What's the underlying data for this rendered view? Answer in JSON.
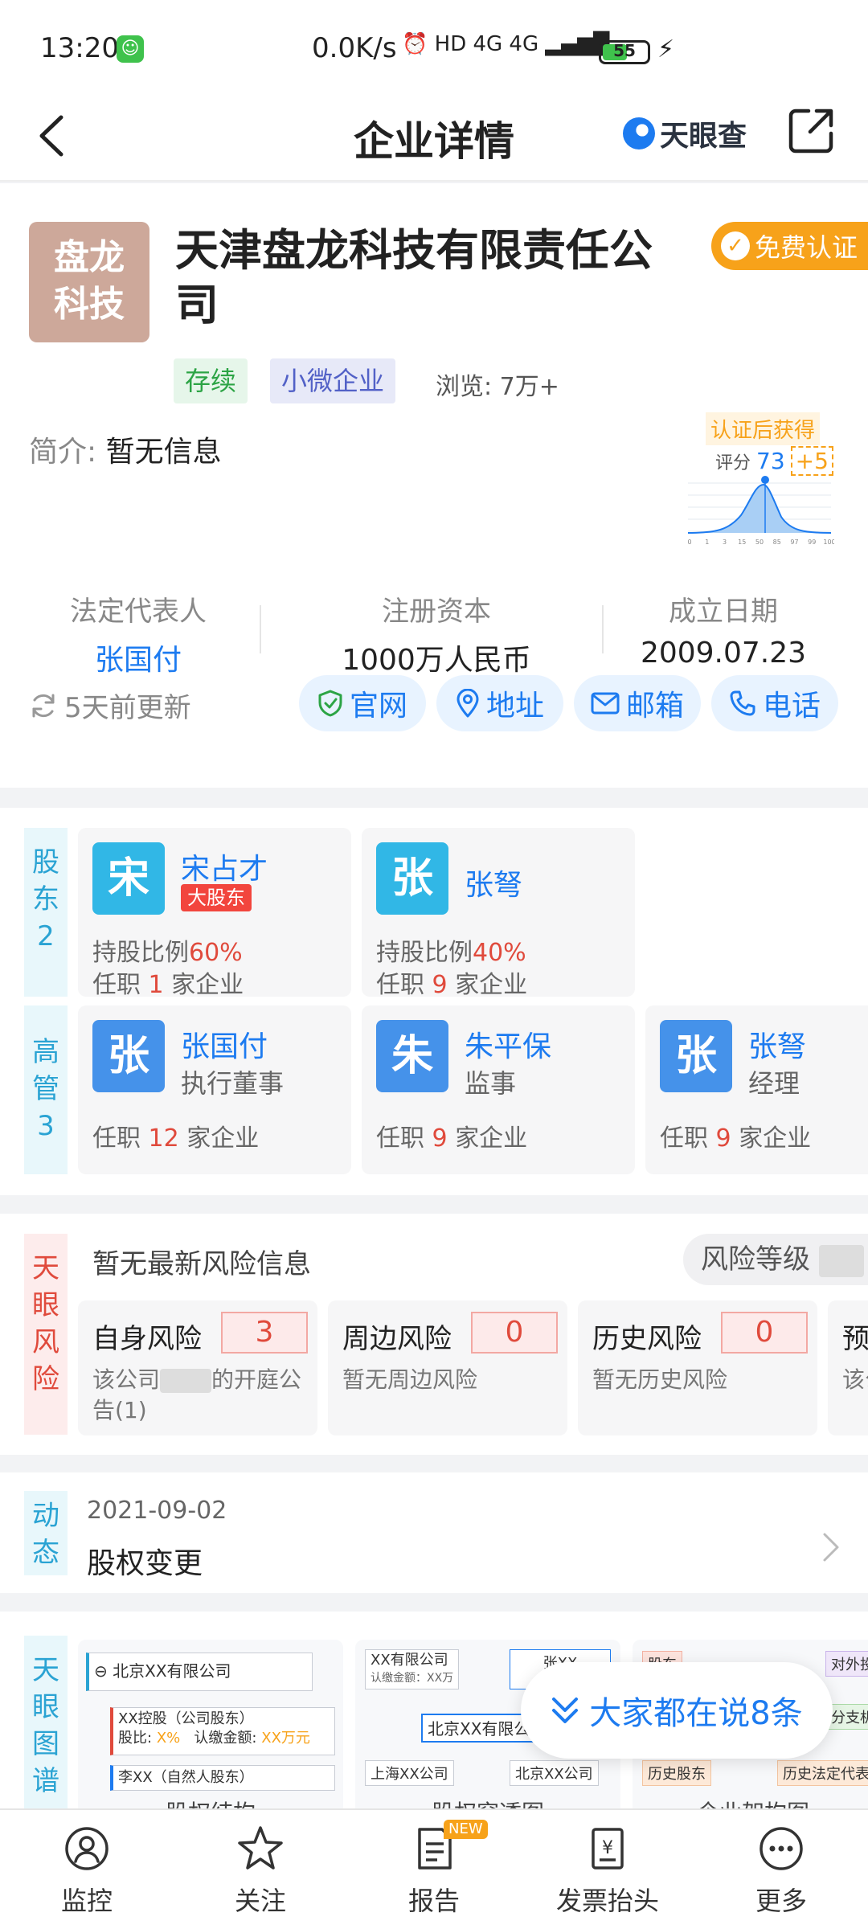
{
  "status": {
    "time": "13:20",
    "speed": "0.0K/s",
    "net": "HD 4G 4G",
    "battery": "55",
    "battery_level": 0.55
  },
  "nav": {
    "title": "企业详情",
    "logo_text": "天眼查"
  },
  "company": {
    "logo_line1": "盘龙",
    "logo_line2": "科技",
    "name": "天津盘龙科技有限责任公司",
    "cert_label": "免费认证",
    "tags": [
      "存续",
      "小微企业"
    ],
    "views_label": "浏览:",
    "views": "7万+",
    "intro_label": "简介:",
    "intro": "暂无信息",
    "score_header": "认证后获得",
    "score_label": "评分",
    "score": "73",
    "score_plus": "+5",
    "score_axis": [
      "0",
      "1",
      "3",
      "15",
      "50",
      "85",
      "97",
      "99",
      "100"
    ],
    "legal_rep_label": "法定代表人",
    "legal_rep": "张国付",
    "capital_label": "注册资本",
    "capital": "1000万人民币",
    "founded_label": "成立日期",
    "founded": "2009.07.23",
    "updated": "5天前更新",
    "actions": [
      "官网",
      "地址",
      "邮箱",
      "电话"
    ]
  },
  "shareholders": {
    "side_label": "股\n东\n2",
    "items": [
      {
        "avatar": "宋",
        "name": "宋占才",
        "badge": "大股东",
        "ratio_label": "持股比例",
        "ratio": "60%",
        "job_pre": "任职",
        "job_num": "1",
        "job_post": "家企业"
      },
      {
        "avatar": "张",
        "name": "张弩",
        "badge": "",
        "ratio_label": "持股比例",
        "ratio": "40%",
        "job_pre": "任职",
        "job_num": "9",
        "job_post": "家企业"
      }
    ]
  },
  "executives": {
    "side_label": "高\n管\n3",
    "items": [
      {
        "avatar": "张",
        "name": "张国付",
        "role": "执行董事",
        "job_pre": "任职",
        "job_num": "12",
        "job_post": "家企业"
      },
      {
        "avatar": "朱",
        "name": "朱平保",
        "role": "监事",
        "job_pre": "任职",
        "job_num": "9",
        "job_post": "家企业"
      },
      {
        "avatar": "张",
        "name": "张弩",
        "role": "经理",
        "job_pre": "任职",
        "job_num": "9",
        "job_post": "家企业"
      }
    ]
  },
  "risk": {
    "side_label": "天\n眼\n风\n险",
    "header": "暂无最新风险信息",
    "level_label": "风险等级",
    "cards": [
      {
        "name": "自身风险",
        "count": "3",
        "desc_pre": "该公司",
        "desc_post": "的开庭公告(1)"
      },
      {
        "name": "周边风险",
        "count": "0",
        "desc_pre": "暂无周边风险",
        "desc_post": ""
      },
      {
        "name": "历史风险",
        "count": "0",
        "desc_pre": "暂无历史风险",
        "desc_post": ""
      },
      {
        "name": "预",
        "count": "",
        "desc_pre": "该公",
        "desc_post": ""
      }
    ]
  },
  "dynamic": {
    "side_label": "动\n态",
    "date": "2021-09-02",
    "text": "股权变更"
  },
  "graph": {
    "side_label": "天\n眼\n图\n谱",
    "thumb1": {
      "root": "北京XX有限公司",
      "child": "XX控股（公司股东）",
      "child_ratio_label": "股比:",
      "child_ratio": "X%",
      "child_amt_label": "认缴金额:",
      "child_amt": "XX万元",
      "person": "李XX（自然人股东）",
      "caption": "股权结构"
    },
    "thumb2": {
      "top_left": "XX有限公司",
      "top_left_sub": "认缴金额：XX万",
      "top_right": "张XX",
      "center": "北京XX有限公司",
      "bottom_left": "上海XX公司",
      "bottom_right": "北京XX公司",
      "caption": "股权穿透图"
    },
    "thumb3": {
      "box1": "股东",
      "box2": "对外投",
      "box3": "分支机",
      "box4": "历史股东",
      "box5": "历史法定代表",
      "caption": "企业架构图"
    }
  },
  "float_button": "大家都在说8条",
  "tabbar": [
    {
      "label": "监控",
      "icon": "monitor-icon"
    },
    {
      "label": "关注",
      "icon": "star-icon"
    },
    {
      "label": "报告",
      "icon": "report-icon",
      "badge": "NEW"
    },
    {
      "label": "发票抬头",
      "icon": "invoice-icon"
    },
    {
      "label": "更多",
      "icon": "more-icon"
    }
  ],
  "colors": {
    "accent": "#1d7bf0",
    "orange": "#f7a21a",
    "red": "#e04a3c",
    "green": "#2ca445"
  }
}
